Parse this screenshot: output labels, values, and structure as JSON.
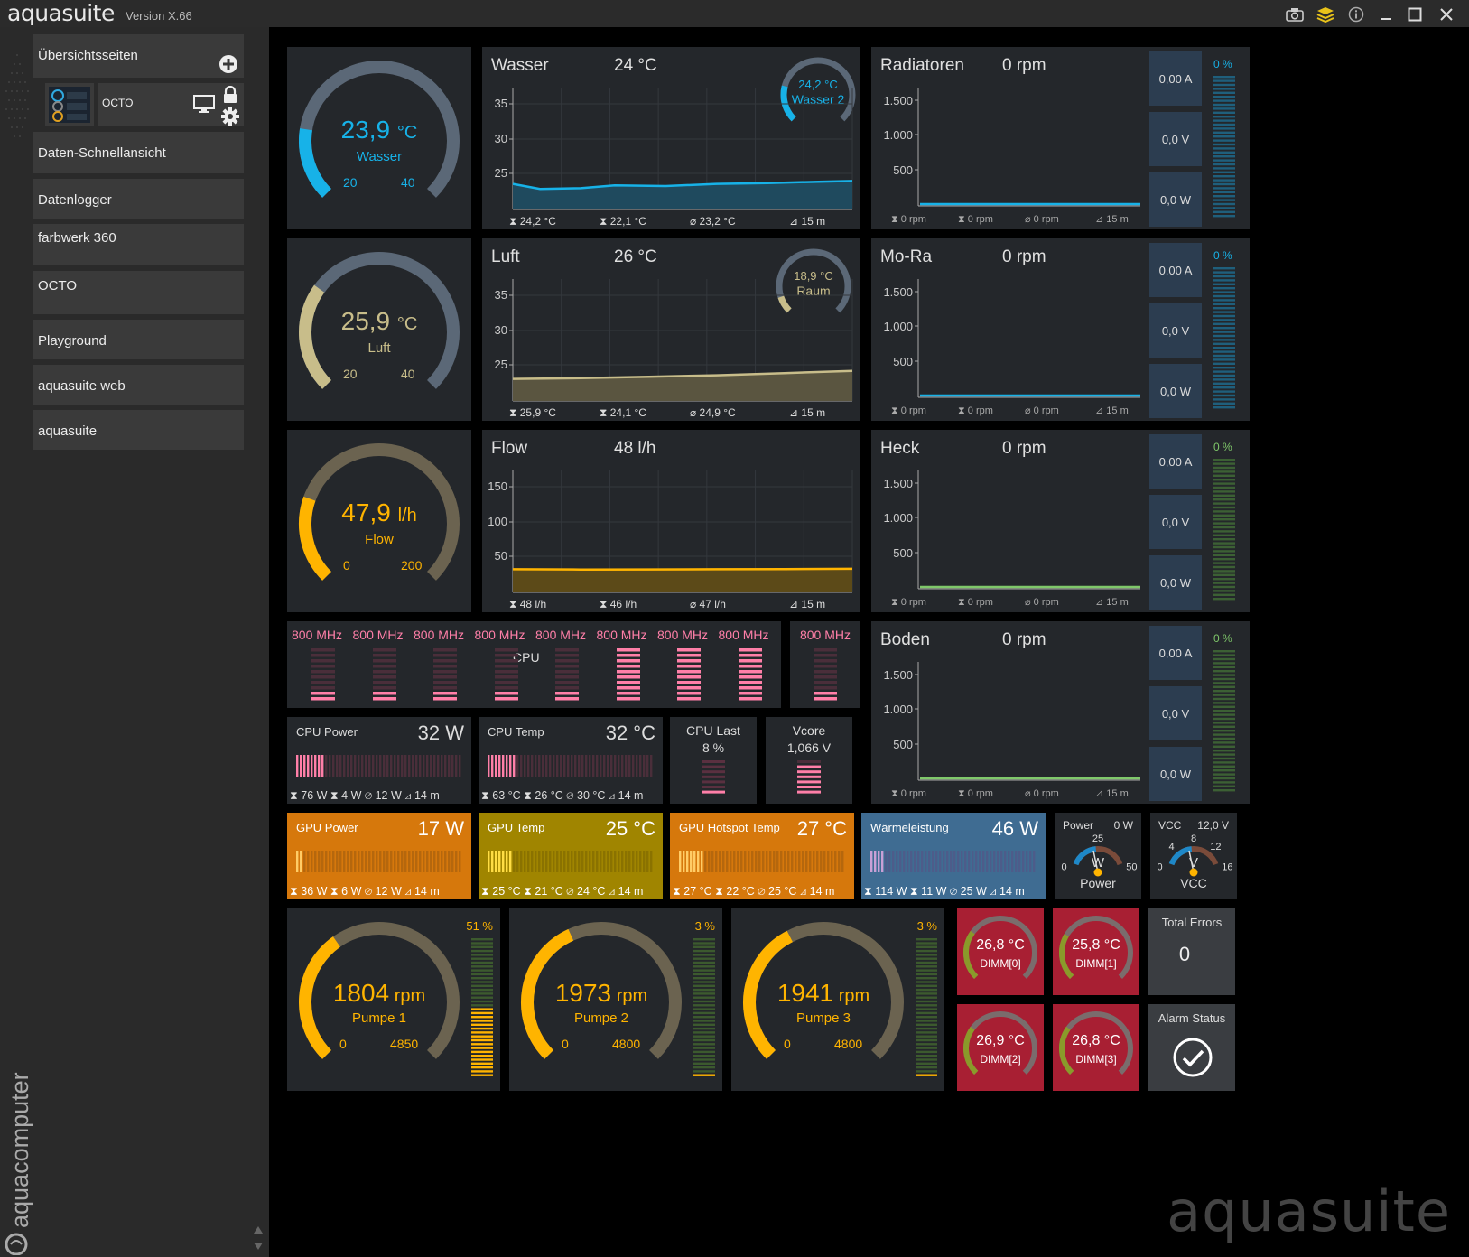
{
  "app": {
    "logo": "aquasuite",
    "version": "Version X.66",
    "watermark": "aquasuite",
    "vertical_brand": "aquacomputer"
  },
  "sidebar": {
    "overview": "Übersichtsseiten",
    "octo_label": "OCTO",
    "items": [
      "Daten-Schnellansicht",
      "Datenlogger",
      "farbwerk 360",
      "OCTO",
      "Playground",
      "aquasuite web",
      "aquasuite"
    ]
  },
  "colors": {
    "blue": "#17b2e8",
    "tan": "#c8bd8a",
    "orange": "#ffb400",
    "pink": "#ff7fa8",
    "green": "#7fc86a",
    "gpu_orange": "#d6780c",
    "gpu_olive": "#a08500",
    "waerme_blue": "#3f6c92",
    "dimm_red": "#a81f33"
  },
  "gauges": [
    {
      "value": "23,9",
      "unit": "°C",
      "label": "Wasser",
      "min": "20",
      "max": "40",
      "fraction": 0.2
    },
    {
      "value": "25,9",
      "unit": "°C",
      "label": "Luft",
      "min": "20",
      "max": "40",
      "fraction": 0.3
    },
    {
      "value": "47,9",
      "unit": "l/h",
      "label": "Flow",
      "min": "0",
      "max": "200",
      "fraction": 0.24
    }
  ],
  "charts": [
    {
      "title": "Wasser",
      "value": "24 °C",
      "mini_value": "24,2 °C",
      "mini_label": "Wasser 2",
      "yticks": [
        "35",
        "30",
        "25"
      ],
      "footer": [
        "24,2 °C",
        "22,1 °C",
        "23,2 °C",
        "15 m"
      ]
    },
    {
      "title": "Luft",
      "value": "26 °C",
      "mini_value": "18,9 °C",
      "mini_label": "Raum",
      "yticks": [
        "35",
        "30",
        "25"
      ],
      "footer": [
        "25,9 °C",
        "24,1 °C",
        "24,9 °C",
        "15 m"
      ]
    },
    {
      "title": "Flow",
      "value": "48 l/h",
      "yticks": [
        "150",
        "100",
        "50"
      ],
      "footer": [
        "48 l/h",
        "46 l/h",
        "47 l/h",
        "15 m"
      ]
    }
  ],
  "fans": [
    {
      "title": "Radiatoren",
      "value": "0 rpm",
      "amps": "0,00 A",
      "volts": "0,0 V",
      "watts": "0,0 W",
      "percent": "0 %",
      "yticks": [
        "1.500",
        "1.000",
        "500"
      ],
      "footer": [
        "0 rpm",
        "0 rpm",
        "0 rpm",
        "15 m"
      ]
    },
    {
      "title": "Mo-Ra",
      "value": "0 rpm",
      "amps": "0,00 A",
      "volts": "0,0 V",
      "watts": "0,0 W",
      "percent": "0 %",
      "yticks": [
        "1.500",
        "1.000",
        "500"
      ],
      "footer": [
        "0 rpm",
        "0 rpm",
        "0 rpm",
        "15 m"
      ]
    },
    {
      "title": "Heck",
      "value": "0 rpm",
      "amps": "0,00 A",
      "volts": "0,0 V",
      "watts": "0,0 W",
      "percent": "0 %",
      "yticks": [
        "1.500",
        "1.000",
        "500"
      ],
      "footer": [
        "0 rpm",
        "0 rpm",
        "0 rpm",
        "15 m"
      ]
    },
    {
      "title": "Boden",
      "value": "0 rpm",
      "amps": "0,00 A",
      "volts": "0,0 V",
      "watts": "0,0 W",
      "percent": "0 %",
      "yticks": [
        "1.500",
        "1.000",
        "500"
      ],
      "footer": [
        "0 rpm",
        "0 rpm",
        "0 rpm",
        "15 m"
      ]
    }
  ],
  "cpu_cores": {
    "label": "CPU",
    "freqs": [
      "800 MHz",
      "800 MHz",
      "800 MHz",
      "800 MHz",
      "800 MHz",
      "800 MHz",
      "800 MHz",
      "800 MHz"
    ],
    "levels": [
      0.2,
      0.2,
      0.2,
      0.2,
      0.2,
      0.95,
      0.95,
      0.95
    ],
    "extra_freq": "800 MHz",
    "extra_level": 0.2
  },
  "metrics": [
    {
      "title": "CPU Power",
      "value": "32 W",
      "fraction": 0.18,
      "footer": [
        "76 W",
        "4 W",
        "12 W",
        "14 m"
      ]
    },
    {
      "title": "CPU Temp",
      "value": "32 °C",
      "fraction": 0.18,
      "footer": [
        "63 °C",
        "26 °C",
        "30 °C",
        "14 m"
      ]
    },
    {
      "title": "GPU Power",
      "value": "17 W",
      "fraction": 0.05,
      "footer": [
        "36 W",
        "6 W",
        "12 W",
        "14 m"
      ]
    },
    {
      "title": "GPU Temp",
      "value": "25 °C",
      "fraction": 0.15,
      "footer": [
        "25 °C",
        "21 °C",
        "24 °C",
        "14 m"
      ]
    },
    {
      "title": "GPU Hotspot Temp",
      "value": "27 °C",
      "fraction": 0.15,
      "footer": [
        "27 °C",
        "22 °C",
        "25 °C",
        "14 m"
      ]
    },
    {
      "title": "Wärmeleistung",
      "value": "46 W",
      "fraction": 0.08,
      "footer": [
        "114 W",
        "11 W",
        "25 W",
        "14 m"
      ]
    }
  ],
  "cpu_last": {
    "title": "CPU Last",
    "value": "8 %",
    "fraction": 0.08
  },
  "vcore": {
    "title": "Vcore",
    "value": "1,066 V",
    "fraction": 0.9
  },
  "power_dial": {
    "title": "Power",
    "value": "0 W",
    "label": "Power",
    "unit": "W",
    "ticks": [
      "0",
      "25",
      "50"
    ]
  },
  "vcc_dial": {
    "title": "VCC",
    "value": "12,0 V",
    "label": "VCC",
    "unit": "V",
    "ticks": [
      "0",
      "4",
      "8",
      "12",
      "16"
    ]
  },
  "pumps": [
    {
      "value": "1804",
      "unit": "rpm",
      "label": "Pumpe 1",
      "min": "0",
      "max": "4850",
      "percent": "51 %",
      "fraction": 0.37,
      "level": 0.51
    },
    {
      "value": "1973",
      "unit": "rpm",
      "label": "Pumpe 2",
      "min": "0",
      "max": "4800",
      "percent": "3 %",
      "fraction": 0.41,
      "level": 0.03
    },
    {
      "value": "1941",
      "unit": "rpm",
      "label": "Pumpe 3",
      "min": "0",
      "max": "4800",
      "percent": "3 %",
      "fraction": 0.4,
      "level": 0.03
    }
  ],
  "dimms": [
    {
      "value": "26,8 °C",
      "label": "DIMM[0]",
      "fraction": 0.3
    },
    {
      "value": "25,8 °C",
      "label": "DIMM[1]",
      "fraction": 0.28
    },
    {
      "value": "26,9 °C",
      "label": "DIMM[2]",
      "fraction": 0.3
    },
    {
      "value": "26,8 °C",
      "label": "DIMM[3]",
      "fraction": 0.3
    }
  ],
  "errors": {
    "title": "Total Errors",
    "value": "0"
  },
  "alarm": {
    "title": "Alarm Status"
  }
}
